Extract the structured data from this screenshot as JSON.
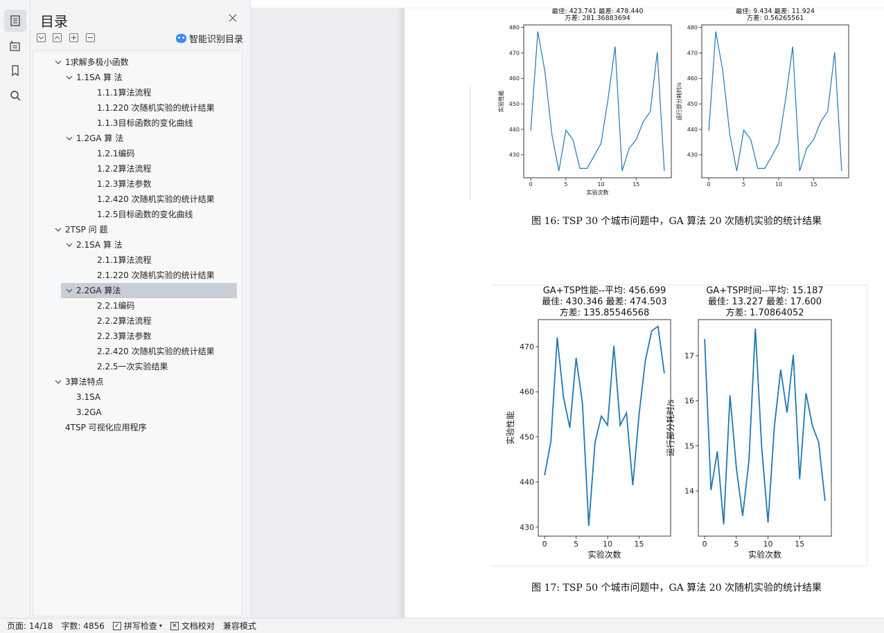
{
  "sidebar": {
    "title": "目录",
    "smart_label": "智能识别目录",
    "items": [
      {
        "label": "1求解多极小函数",
        "level": 0,
        "expanded": true
      },
      {
        "label": "1.1SA 算 法",
        "level": 1,
        "expanded": true
      },
      {
        "label": "1.1.1算法流程",
        "level": 2
      },
      {
        "label": "1.1.220 次随机实验的统计结果",
        "level": 2
      },
      {
        "label": "1.1.3目标函数的变化曲线",
        "level": 2
      },
      {
        "label": "1.2GA 算 法",
        "level": 1,
        "expanded": true
      },
      {
        "label": "1.2.1编码",
        "level": 2
      },
      {
        "label": "1.2.2算法流程",
        "level": 2
      },
      {
        "label": "1.2.3算法参数",
        "level": 2
      },
      {
        "label": "1.2.420 次随机实验的统计结果",
        "level": 2
      },
      {
        "label": "1.2.5目标函数的变化曲线",
        "level": 2
      },
      {
        "label": "2TSP 问 题",
        "level": 0,
        "expanded": true
      },
      {
        "label": "2.1SA 算 法",
        "level": 1,
        "expanded": true
      },
      {
        "label": "2.1.1算法流程",
        "level": 2
      },
      {
        "label": "2.1.220 次随机实验的统计结果",
        "level": 2
      },
      {
        "label": "2.2GA 算法",
        "level": 1,
        "expanded": true,
        "selected": true
      },
      {
        "label": "2.2.1编码",
        "level": 2
      },
      {
        "label": "2.2.2算法流程",
        "level": 2
      },
      {
        "label": "2.2.3算法参数",
        "level": 2
      },
      {
        "label": "2.2.420 次随机实验的统计结果",
        "level": 2
      },
      {
        "label": "2.2.5一次实验结果",
        "level": 2
      },
      {
        "label": "3算法特点",
        "level": 0,
        "expanded": true
      },
      {
        "label": "3.1SA",
        "level": 1
      },
      {
        "label": "3.2GA",
        "level": 1
      },
      {
        "label": "4TSP 可视化应用程序",
        "level": 0
      }
    ]
  },
  "document": {
    "caption16": "图 16: TSP 30 个城市问题中，GA 算法 20 次随机实验的统计结果",
    "caption17": "图 17: TSP 50 个城市问题中，GA 算法 20 次随机实验的统计结果"
  },
  "status": {
    "page": "页面: 14/18",
    "words": "字数: 4856",
    "spell": "拼写检查",
    "proof": "文档校对",
    "compat": "兼容模式"
  },
  "colors": {
    "line": "#1f77b4",
    "selected_row": "#c8ced6",
    "accent": "#3d8af7"
  },
  "chart_data": [
    {
      "type": "line",
      "title": "最佳: 423.741  最差: 478.440\n方差: 281.36883694",
      "title_lines": [
        "最佳: 423.741  最差: 478.440",
        "方差: 281.36883694"
      ],
      "xlabel": "实验次数",
      "ylabel": "实验性能",
      "xlim": [
        -1,
        20
      ],
      "ylim": [
        421,
        481
      ],
      "xticks": [
        0,
        5,
        10,
        15
      ],
      "yticks": [
        430,
        440,
        450,
        460,
        470,
        480
      ],
      "x": [
        0,
        1,
        2,
        3,
        4,
        5,
        6,
        7,
        8,
        9,
        10,
        11,
        12,
        13,
        14,
        15,
        16,
        17,
        18,
        19
      ],
      "values": [
        439.5,
        478.4,
        463,
        438,
        423.7,
        439.7,
        436,
        424.7,
        424.7,
        429.5,
        434.5,
        452,
        472.5,
        423.7,
        432.5,
        436,
        443,
        447,
        470.3,
        423.7
      ]
    },
    {
      "type": "line",
      "title_lines": [
        "最佳: 9.434  最差: 11.924",
        "方差: 0.56265561"
      ],
      "xlabel": "",
      "ylabel": "运行部分耗时/s",
      "xlim": [
        -1,
        20
      ],
      "ylim": [
        421,
        481
      ],
      "xticks": [
        0,
        5,
        10,
        15
      ],
      "yticks": [
        430,
        440,
        450,
        460,
        470,
        480
      ],
      "x": [
        0,
        1,
        2,
        3,
        4,
        5,
        6,
        7,
        8,
        9,
        10,
        11,
        12,
        13,
        14,
        15,
        16,
        17,
        18,
        19
      ],
      "values": [
        439.5,
        478.4,
        463,
        438,
        423.7,
        439.7,
        436,
        424.7,
        424.7,
        429.5,
        434.5,
        452,
        472.5,
        423.7,
        432.5,
        436,
        443,
        447,
        470.3,
        423.7
      ]
    },
    {
      "type": "line",
      "title_lines": [
        "GA+TSP性能--平均: 456.699",
        "最佳: 430.346  最差: 474.503",
        "方差: 135.85546568"
      ],
      "xlabel": "实验次数",
      "ylabel": "实验性能",
      "xlim": [
        -1,
        20
      ],
      "ylim": [
        428,
        476
      ],
      "xticks": [
        0,
        5,
        10,
        15
      ],
      "yticks": [
        430,
        440,
        450,
        460,
        470
      ],
      "x": [
        0,
        1,
        2,
        3,
        4,
        5,
        6,
        7,
        8,
        9,
        10,
        11,
        12,
        13,
        14,
        15,
        16,
        17,
        18,
        19
      ],
      "values": [
        441.5,
        449,
        472,
        458.8,
        452,
        467.5,
        457.5,
        430.3,
        448.8,
        454.6,
        452.6,
        470.2,
        452.6,
        455.3,
        439.3,
        455,
        467,
        473.5,
        474.5,
        464.1
      ]
    },
    {
      "type": "line",
      "title_lines": [
        "GA+TSP时间--平均: 15.187",
        "最佳: 13.227  最差: 17.600",
        "方差: 1.70864052"
      ],
      "xlabel": "实验次数",
      "ylabel": "运行部分耗时/s",
      "xlim": [
        -1,
        20
      ],
      "ylim": [
        13.0,
        17.8
      ],
      "xticks": [
        0,
        5,
        10,
        15
      ],
      "yticks": [
        14,
        15,
        16,
        17
      ],
      "x": [
        0,
        1,
        2,
        3,
        4,
        5,
        6,
        7,
        8,
        9,
        10,
        11,
        12,
        13,
        14,
        15,
        16,
        17,
        18,
        19
      ],
      "values": [
        17.37,
        14.02,
        14.88,
        13.26,
        16.12,
        14.51,
        13.45,
        14.68,
        17.6,
        14.98,
        13.3,
        15.42,
        16.69,
        15.74,
        17.02,
        14.26,
        16.17,
        15.45,
        15.08,
        13.78
      ]
    }
  ]
}
